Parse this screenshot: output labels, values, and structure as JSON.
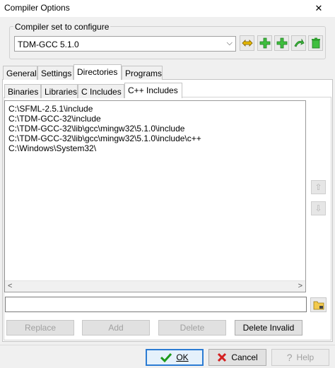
{
  "window": {
    "title": "Compiler Options",
    "close_glyph": "✕"
  },
  "compiler_set": {
    "label": "Compiler set to configure",
    "selected": "TDM-GCC 5.1.0",
    "toolbar_icons": [
      "rename-set-icon",
      "add-set-icon",
      "add-set-from-folder-icon",
      "find-sets-icon",
      "delete-set-icon"
    ]
  },
  "outer_tabs": [
    {
      "label": "General",
      "active": false
    },
    {
      "label": "Settings",
      "active": false
    },
    {
      "label": "Directories",
      "active": true
    },
    {
      "label": "Programs",
      "active": false
    }
  ],
  "inner_tabs": [
    {
      "label": "Binaries",
      "active": false
    },
    {
      "label": "Libraries",
      "active": false
    },
    {
      "label": "C Includes",
      "active": false
    },
    {
      "label": "C++ Includes",
      "active": true
    }
  ],
  "directories": [
    "C:\\SFML-2.5.1\\include",
    "C:\\TDM-GCC-32\\include",
    "C:\\TDM-GCC-32\\lib\\gcc\\mingw32\\5.1.0\\include",
    "C:\\TDM-GCC-32\\lib\\gcc\\mingw32\\5.1.0\\include\\c++",
    "C:\\Windows\\System32\\"
  ],
  "path_input": {
    "value": ""
  },
  "actions": {
    "replace": "Replace",
    "add": "Add",
    "delete": "Delete",
    "delete_invalid": "Delete Invalid"
  },
  "dialog": {
    "ok": "OK",
    "cancel": "Cancel",
    "help": "Help"
  },
  "colors": {
    "accent": "#2b7bd3",
    "ok_check": "#1c9a1c",
    "cancel_x": "#d42020"
  }
}
